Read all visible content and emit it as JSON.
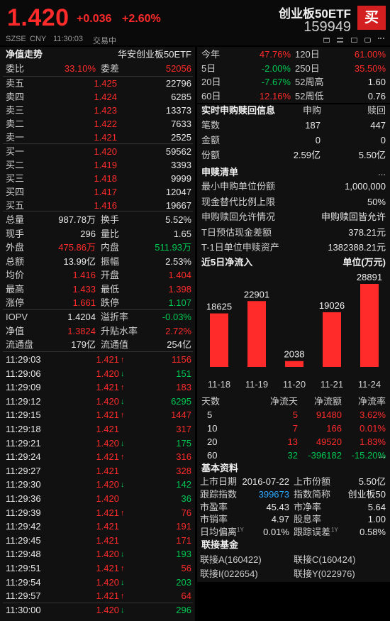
{
  "header": {
    "price": "1.420",
    "change": "+0.036",
    "change_pct": "+2.60%",
    "exchange": "SZSE",
    "currency": "CNY",
    "time": "11:30:03",
    "status": "交易中",
    "name": "创业板50ETF",
    "code": "159949",
    "buy_label": "买",
    "icons": [
      "chart-icon",
      "list-icon",
      "grid-icon",
      "settings-icon",
      "more-icon"
    ]
  },
  "left": {
    "title": "净值走势",
    "fund_name": "华安创业板50ETF",
    "webi_label": "委比",
    "webi_value": "33.10%",
    "weicha_label": "委差",
    "weicha_value": "52056",
    "asks": [
      {
        "label": "卖五",
        "price": "1.425",
        "vol": "22796"
      },
      {
        "label": "卖四",
        "price": "1.424",
        "vol": "6285"
      },
      {
        "label": "卖三",
        "price": "1.423",
        "vol": "13373"
      },
      {
        "label": "卖二",
        "price": "1.422",
        "vol": "7633"
      },
      {
        "label": "卖一",
        "price": "1.421",
        "vol": "2525"
      }
    ],
    "bids": [
      {
        "label": "买一",
        "price": "1.420",
        "vol": "59562"
      },
      {
        "label": "买二",
        "price": "1.419",
        "vol": "3393"
      },
      {
        "label": "买三",
        "price": "1.418",
        "vol": "9999"
      },
      {
        "label": "买四",
        "price": "1.417",
        "vol": "12047"
      },
      {
        "label": "买五",
        "price": "1.416",
        "vol": "19667"
      }
    ],
    "stats": [
      {
        "l1": "总量",
        "v1": "987.78万",
        "c1": "white",
        "l2": "换手",
        "v2": "5.52%",
        "c2": "white"
      },
      {
        "l1": "现手",
        "v1": "296",
        "c1": "white",
        "l2": "量比",
        "v2": "1.65",
        "c2": "white"
      },
      {
        "l1": "外盘",
        "v1": "475.86万",
        "c1": "red",
        "l2": "内盘",
        "v2": "511.93万",
        "c2": "green"
      },
      {
        "l1": "总额",
        "v1": "13.99亿",
        "c1": "white",
        "l2": "振幅",
        "v2": "2.53%",
        "c2": "white"
      },
      {
        "l1": "均价",
        "v1": "1.416",
        "c1": "red",
        "l2": "开盘",
        "v2": "1.404",
        "c2": "red"
      },
      {
        "l1": "最高",
        "v1": "1.433",
        "c1": "red",
        "l2": "最低",
        "v2": "1.398",
        "c2": "red"
      },
      {
        "l1": "涨停",
        "v1": "1.661",
        "c1": "red",
        "l2": "跌停",
        "v2": "1.107",
        "c2": "green"
      }
    ],
    "nav": [
      {
        "l1": "IOPV",
        "v1": "1.4204",
        "c1": "white",
        "l2": "溢折率",
        "v2": "-0.03%",
        "c2": "green"
      },
      {
        "l1": "净值",
        "v1": "1.3824",
        "c1": "red",
        "l2": "升贴水率",
        "v2": "2.72%",
        "c2": "red"
      },
      {
        "l1": "流通盘",
        "v1": "179亿",
        "c1": "white",
        "l2": "流通值",
        "v2": "254亿",
        "c2": "white"
      }
    ],
    "ticks": [
      {
        "t": "11:29:03",
        "p": "1.421",
        "pc": "red",
        "d": "up",
        "v": "1156",
        "vc": "red"
      },
      {
        "t": "11:29:06",
        "p": "1.420",
        "pc": "red",
        "d": "down",
        "v": "151",
        "vc": "green"
      },
      {
        "t": "11:29:09",
        "p": "1.421",
        "pc": "red",
        "d": "up",
        "v": "183",
        "vc": "red"
      },
      {
        "t": "11:29:12",
        "p": "1.420",
        "pc": "red",
        "d": "down",
        "v": "6295",
        "vc": "green"
      },
      {
        "t": "11:29:15",
        "p": "1.421",
        "pc": "red",
        "d": "up",
        "v": "1447",
        "vc": "red"
      },
      {
        "t": "11:29:18",
        "p": "1.421",
        "pc": "red",
        "d": "",
        "v": "317",
        "vc": "red"
      },
      {
        "t": "11:29:21",
        "p": "1.420",
        "pc": "red",
        "d": "down",
        "v": "175",
        "vc": "green"
      },
      {
        "t": "11:29:24",
        "p": "1.421",
        "pc": "red",
        "d": "up",
        "v": "316",
        "vc": "red"
      },
      {
        "t": "11:29:27",
        "p": "1.421",
        "pc": "red",
        "d": "",
        "v": "328",
        "vc": "red"
      },
      {
        "t": "11:29:30",
        "p": "1.420",
        "pc": "red",
        "d": "down",
        "v": "142",
        "vc": "green"
      },
      {
        "t": "11:29:36",
        "p": "1.420",
        "pc": "red",
        "d": "",
        "v": "36",
        "vc": "green"
      },
      {
        "t": "11:29:39",
        "p": "1.421",
        "pc": "red",
        "d": "up",
        "v": "76",
        "vc": "red"
      },
      {
        "t": "11:29:42",
        "p": "1.421",
        "pc": "red",
        "d": "",
        "v": "191",
        "vc": "red"
      },
      {
        "t": "11:29:45",
        "p": "1.421",
        "pc": "red",
        "d": "",
        "v": "171",
        "vc": "red"
      },
      {
        "t": "11:29:48",
        "p": "1.420",
        "pc": "red",
        "d": "down",
        "v": "193",
        "vc": "green"
      },
      {
        "t": "11:29:51",
        "p": "1.421",
        "pc": "red",
        "d": "up",
        "v": "56",
        "vc": "red"
      },
      {
        "t": "11:29:54",
        "p": "1.420",
        "pc": "red",
        "d": "down",
        "v": "203",
        "vc": "green"
      },
      {
        "t": "11:29:57",
        "p": "1.421",
        "pc": "red",
        "d": "up",
        "v": "64",
        "vc": "red"
      },
      {
        "t": "11:30:00",
        "p": "1.420",
        "pc": "red",
        "d": "down",
        "v": "296",
        "vc": "green"
      }
    ]
  },
  "right": {
    "perf": [
      {
        "l1": "今年",
        "v1": "47.76%",
        "c1": "red",
        "l2": "120日",
        "v2": "61.00%",
        "c2": "red"
      },
      {
        "l1": "5日",
        "v1": "-2.00%",
        "c1": "green",
        "l2": "250日",
        "v2": "35.50%",
        "c2": "red"
      },
      {
        "l1": "20日",
        "v1": "-7.67%",
        "c1": "green",
        "l2": "52周高",
        "v2": "1.60",
        "c2": "white"
      },
      {
        "l1": "60日",
        "v1": "12.16%",
        "c1": "red",
        "l2": "52周低",
        "v2": "0.76",
        "c2": "white"
      }
    ],
    "redeem_info": {
      "title": "实时申购赎回信息",
      "col1": "申购",
      "col2": "赎回",
      "rows": [
        {
          "l": "笔数",
          "a": "187",
          "b": "447"
        },
        {
          "l": "金额",
          "a": "0",
          "b": "0"
        },
        {
          "l": "份额",
          "a": "2.59亿",
          "b": "5.50亿"
        }
      ]
    },
    "redeem_list": {
      "title": "申赎清单",
      "more": "...",
      "rows": [
        {
          "l": "最小申购单位份额",
          "v": "1,000,000"
        },
        {
          "l": "现金替代比例上限",
          "v": "50%"
        },
        {
          "l": "申购赎回允许情况",
          "v": "申购赎回皆允许"
        },
        {
          "l": "T日预估现金差额",
          "v": "378.21元"
        },
        {
          "l": "T-1日单位申赎资产",
          "v": "1382388.21元"
        }
      ]
    },
    "inflow": {
      "title": "近5日净流入",
      "unit": "单位(万元)"
    },
    "flow_table": {
      "headers": [
        "天数",
        "净流天",
        "净流额",
        "净流率"
      ],
      "rows": [
        {
          "d": "5",
          "n": "5",
          "a": "91480",
          "r": "3.62%",
          "c": "red"
        },
        {
          "d": "10",
          "n": "7",
          "a": "166",
          "r": "0.01%",
          "c": "red"
        },
        {
          "d": "20",
          "n": "13",
          "a": "49520",
          "r": "1.83%",
          "c": "red"
        },
        {
          "d": "60",
          "n": "32",
          "a": "-396182",
          "r": "-15.20%",
          "c": "green"
        }
      ],
      "more": "..."
    },
    "basic": {
      "title": "基本资料",
      "rows": [
        {
          "l1": "上市日期",
          "v1": "2016-07-22",
          "c1": "white",
          "l2": "上市份额",
          "v2": "5.50亿",
          "c2": "white"
        },
        {
          "l1": "跟踪指数",
          "v1": "399673",
          "c1": "cyan",
          "l2": "指数简称",
          "v2": "创业板50",
          "c2": "white"
        },
        {
          "l1": "市盈率",
          "v1": "45.43",
          "c1": "white",
          "l2": "市净率",
          "v2": "5.64",
          "c2": "white"
        },
        {
          "l1": "市销率",
          "v1": "4.97",
          "c1": "white",
          "l2": "股息率",
          "v2": "1.00",
          "c2": "white"
        },
        {
          "l1": "日均偏离",
          "s1": "1Y",
          "v1": "0.01%",
          "c1": "white",
          "l2": "跟踪误差",
          "s2": "1Y",
          "v2": "0.58%",
          "c2": "white"
        }
      ]
    },
    "linked": {
      "title": "联接基金",
      "items": [
        "联接A(160422)",
        "联接C(160424)",
        "联接I(022654)",
        "联接Y(022976)"
      ]
    }
  },
  "chart_data": {
    "type": "bar",
    "title": "近5日净流入",
    "ylabel": "单位(万元)",
    "categories": [
      "11-18",
      "11-19",
      "11-20",
      "11-21",
      "11-24"
    ],
    "values": [
      18625,
      22901,
      2038,
      19026,
      28891
    ],
    "colors": {
      "positive": "#ff2b2b"
    }
  }
}
